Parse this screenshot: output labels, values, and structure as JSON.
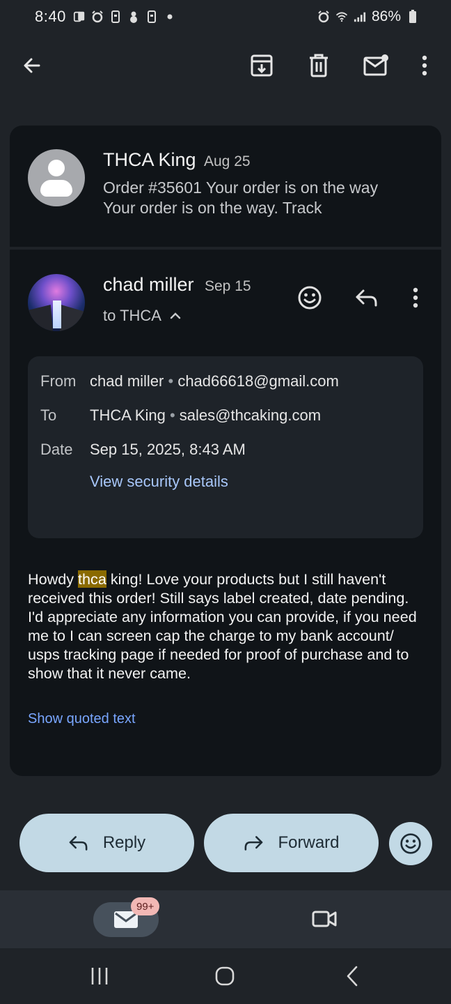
{
  "status_bar": {
    "time": "8:40",
    "battery": "86%"
  },
  "toolbar": {
    "back": "back-arrow-icon",
    "archive": "archive-icon",
    "delete": "trash-icon",
    "mark_unread": "mark-unread-icon",
    "more": "more-vert-icon"
  },
  "messages": [
    {
      "sender": "THCA King",
      "date": "Aug 25",
      "snippet": "Order #35601 Your order is on the way Your order is on the way. Track"
    },
    {
      "sender": "chad miller",
      "date": "Sep 15",
      "to": "to THCA",
      "details": {
        "from_label": "From",
        "from_name": "chad miller",
        "from_email": "chad66618@gmail.com",
        "to_label": "To",
        "to_name": "THCA King",
        "to_email": "sales@thcaking.com",
        "date_label": "Date",
        "date_value": "Sep 15, 2025, 8:43 AM",
        "security_link": "View security details"
      },
      "body_pre": "Howdy ",
      "body_highlight": "thca",
      "body_post": " king! Love your products but I still haven't received this order! Still says label created, date pending. I'd appreciate any information you can provide, if you need me to I can screen cap the charge to my bank account/ usps tracking page if needed for proof of purchase and to show that it never came.",
      "show_quoted": "Show quoted text"
    }
  ],
  "actions": {
    "reply": "Reply",
    "forward": "Forward"
  },
  "bottom_nav": {
    "mail_badge": "99+"
  },
  "colors": {
    "background": "#1f2328",
    "card": "#101418",
    "pill": "#c2d9e5",
    "link": "#a8c7fa",
    "highlight": "#8a6a00"
  }
}
